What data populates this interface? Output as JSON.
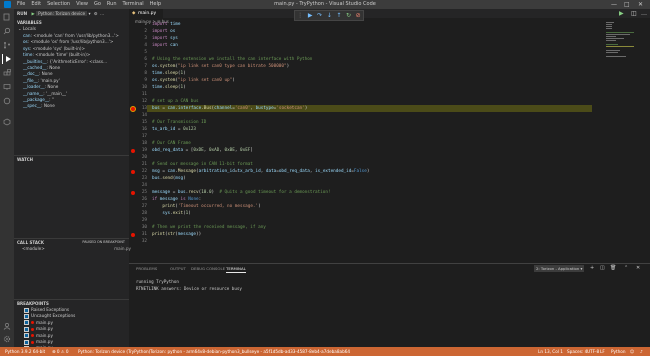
{
  "titlebar": {
    "menu": [
      "File",
      "Edit",
      "Selection",
      "View",
      "Go",
      "Run",
      "Terminal",
      "Help"
    ],
    "title": "main.py - TryPython - Visual Studio Code",
    "controls": [
      "—",
      "□",
      "✕"
    ]
  },
  "debug": {
    "run_label": "RUN",
    "config": "Python: Torizon device"
  },
  "variables": {
    "header": "VARIABLES",
    "scope": "Locals",
    "rows": [
      {
        "name": "can",
        "value": "<module 'can' from '/usr/lib/python3...'>"
      },
      {
        "name": "os",
        "value": "<module 'os' from '/usr/lib/python3...'>"
      },
      {
        "name": "sys",
        "value": "<module 'sys' (built-in)>"
      },
      {
        "name": "time",
        "value": "<module 'time' (built-in)>"
      },
      {
        "name": "__builtins__",
        "value": "{'ArithmeticError': <class..."
      },
      {
        "name": "__cached__",
        "value": "None"
      },
      {
        "name": "__doc__",
        "value": "None"
      },
      {
        "name": "__file__",
        "value": "'main.py'"
      },
      {
        "name": "__loader__",
        "value": "None"
      },
      {
        "name": "__name__",
        "value": "'__main__'"
      },
      {
        "name": "__package__",
        "value": "''"
      },
      {
        "name": "__spec__",
        "value": "None"
      }
    ]
  },
  "watch": {
    "header": "WATCH"
  },
  "callstack": {
    "header": "CALL STACK",
    "status": "PAUSED ON BREAKPOINT",
    "frame": "<module>",
    "file": "main.py"
  },
  "breakpoints": {
    "header": "BREAKPOINTS",
    "items": [
      {
        "label": "Raised Exceptions",
        "line": ""
      },
      {
        "label": "Uncaught Exceptions",
        "line": ""
      },
      {
        "label": "main.py",
        "line": "13"
      },
      {
        "label": "main.py",
        "line": "19"
      },
      {
        "label": "main.py",
        "line": "22"
      },
      {
        "label": "main.py",
        "line": "25"
      },
      {
        "label": "main.py",
        "line": "31"
      }
    ]
  },
  "editor": {
    "tab": "main.py",
    "breadcrumb": "main.py > ⊞ bus",
    "lines": [
      {
        "n": "1",
        "t": "import time"
      },
      {
        "n": "2",
        "t": "import os"
      },
      {
        "n": "3",
        "t": "import sys"
      },
      {
        "n": "4",
        "t": "import can"
      },
      {
        "n": "5",
        "t": ""
      },
      {
        "n": "6",
        "t": "# Using the extension we install the can interface with Python"
      },
      {
        "n": "7",
        "t": "os.system(\"ip link set can0 type can bitrate 500000\")"
      },
      {
        "n": "8",
        "t": "time.sleep(1)"
      },
      {
        "n": "9",
        "t": "os.system(\"ip link set can0 up\")"
      },
      {
        "n": "10",
        "t": "time.sleep(1)"
      },
      {
        "n": "11",
        "t": ""
      },
      {
        "n": "12",
        "t": "# set up a CAN bus"
      },
      {
        "n": "13",
        "t": "bus = can.interface.Bus(channel='can0', bustype='socketcan')"
      },
      {
        "n": "14",
        "t": ""
      },
      {
        "n": "15",
        "t": "# Our Transmission ID"
      },
      {
        "n": "16",
        "t": "tx_arb_id = 0x123"
      },
      {
        "n": "17",
        "t": ""
      },
      {
        "n": "18",
        "t": "# Our CAN Frame"
      },
      {
        "n": "19",
        "t": "obd_req_data = [0xDE, 0xAD, 0xBE, 0xEF]"
      },
      {
        "n": "20",
        "t": ""
      },
      {
        "n": "21",
        "t": "# Send our message in CAN 11-bit format"
      },
      {
        "n": "22",
        "t": "msg = can.Message(arbitration_id=tx_arb_id, data=obd_req_data, is_extended_id=False)"
      },
      {
        "n": "23",
        "t": "bus.send(msg)"
      },
      {
        "n": "24",
        "t": ""
      },
      {
        "n": "25",
        "t": "message = bus.recv(10.0)  # Quits a good timeout for a demonstration!"
      },
      {
        "n": "26",
        "t": "if message is None:"
      },
      {
        "n": "27",
        "t": "    print('Timeout occurred, no message.')"
      },
      {
        "n": "28",
        "t": "    sys.exit(1)"
      },
      {
        "n": "29",
        "t": ""
      },
      {
        "n": "30",
        "t": "# Then we print the received message, if any"
      },
      {
        "n": "31",
        "t": "print(str(message))"
      },
      {
        "n": "32",
        "t": ""
      }
    ]
  },
  "panel": {
    "tabs": [
      "PROBLEMS",
      "OUTPUT",
      "DEBUG CONSOLE",
      "TERMINAL"
    ],
    "active": "TERMINAL",
    "terminal_select": "2: Torizon - Application",
    "terminal_lines": [
      "running TryPython",
      "RTNETLINK answers: Device or resource busy"
    ]
  },
  "statusbar": {
    "python": "Python 3.9.2 64-bit",
    "errors": "⊗ 0  ⚠ 0",
    "debug_target": "Python: Torizon device (TryPython)",
    "device": "Torizon: python - arm64v8-debian-python3_bullseye - a5f1d5db-ad33-4587-8eb4-a7deba8ab64",
    "position": "Ln 13, Col 1",
    "spaces": "Spaces: 4",
    "encoding": "UTF-8",
    "eol": "LF",
    "language": "Python"
  },
  "colors": {
    "status": "#cc6633",
    "breakpoint": "#e51400",
    "highlight": "#4b4b18"
  }
}
